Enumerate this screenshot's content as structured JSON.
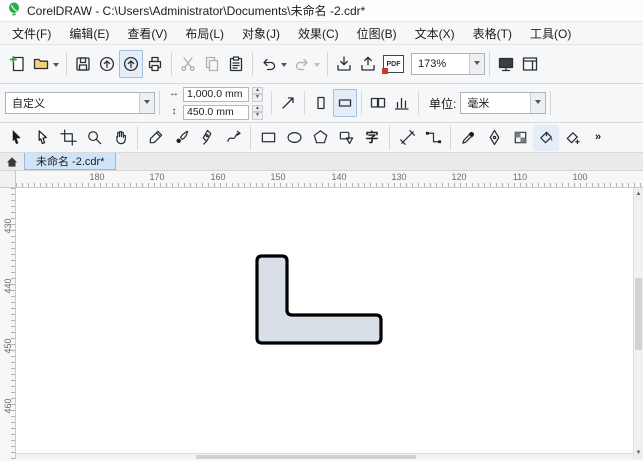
{
  "window": {
    "title": "CorelDRAW - C:\\Users\\Administrator\\Documents\\未命名 -2.cdr*"
  },
  "menubar": {
    "items": [
      "文件(F)",
      "编辑(E)",
      "查看(V)",
      "布局(L)",
      "对象(J)",
      "效果(C)",
      "位图(B)",
      "文本(X)",
      "表格(T)",
      "工具(O)"
    ]
  },
  "standard_toolbar": {
    "zoom_value": "173%",
    "pdf_label": "PDF",
    "icons": [
      "new-document-icon",
      "open-folder-icon",
      "save-icon",
      "cloud-upload-icon",
      "cloud-download-icon",
      "print-icon",
      "cut-icon",
      "copy-icon",
      "paste-icon",
      "undo-icon",
      "redo-icon",
      "import-icon",
      "export-icon",
      "publish-pdf-icon",
      "full-screen-preview-icon",
      "show-dockers-icon"
    ]
  },
  "property_bar": {
    "preset_value": "自定义",
    "width_value": "1,000.0 mm",
    "height_value": "450.0 mm",
    "width_icon": "↔",
    "height_icon": "↕",
    "units_label": "单位:",
    "units_value": "毫米",
    "icons": [
      "page-width-icon",
      "page-height-icon",
      "nudge-offset-icon",
      "portrait-icon",
      "landscape-icon",
      "all-pages-icon",
      "drawing-scale-icon"
    ]
  },
  "toolbox": {
    "text_tool_glyph": "字",
    "overflow_glyph": "»",
    "tools": [
      "pick-tool",
      "shape-edit-tool",
      "crop-tool",
      "zoom-tool",
      "pan-tool",
      "freehand-tool",
      "artistic-media-tool",
      "pen-tool",
      "smart-drawing-tool",
      "rectangle-tool",
      "ellipse-tool",
      "polygon-tool",
      "common-shapes-tool",
      "text-tool",
      "dimension-tool",
      "connector-tool",
      "eyedropper-tool",
      "outline-pen-tool",
      "transparency-tool",
      "interactive-fill-tool",
      "smart-fill-tool"
    ]
  },
  "document_bar": {
    "tab_label": "未命名 -2.cdr*"
  },
  "rulers": {
    "horizontal": [
      "180",
      "170",
      "160",
      "150",
      "140",
      "130",
      "120",
      "110",
      "100"
    ],
    "vertical": [
      "430",
      "440",
      "450",
      "460"
    ]
  },
  "canvas": {
    "shape": {
      "type": "L-shape",
      "fill": "#d8dfe6",
      "stroke": "#000000"
    }
  }
}
